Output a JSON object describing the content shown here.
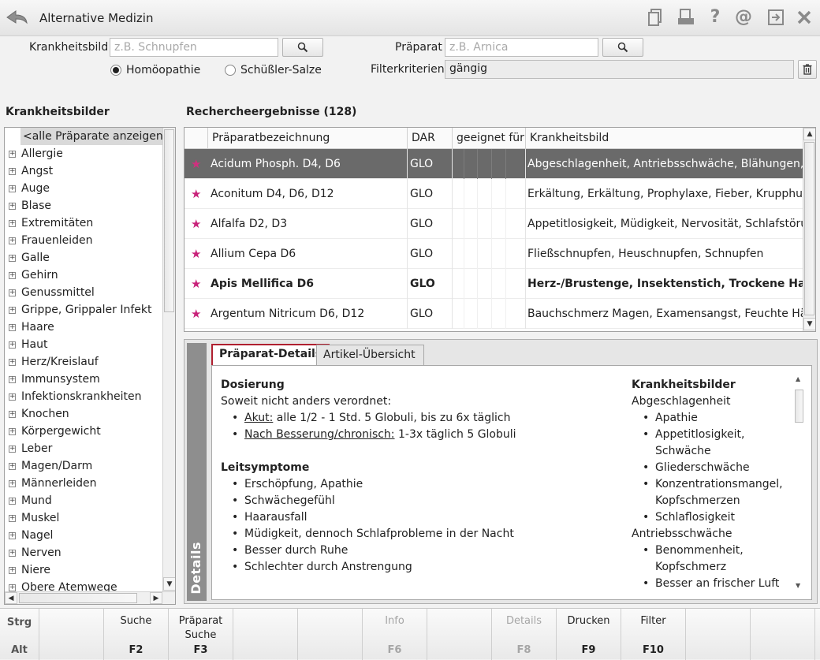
{
  "window": {
    "title": "Alternative Medizin"
  },
  "search": {
    "krankheitsbild_label": "Krankheitsbild",
    "krankheitsbild_placeholder": "z.B. Schnupfen",
    "praeparat_label": "Präparat",
    "praeparat_placeholder": "z.B. Arnica",
    "filter_label": "Filterkriterien",
    "filter_value": "gängig",
    "radio_homoeopathie": "Homöopathie",
    "radio_schuessler": "Schüßler-Salze",
    "selected_radio": "Homöopathie"
  },
  "left_panel": {
    "title": "Krankheitsbilder",
    "selected": "<alle Präparate anzeigen>",
    "items": [
      "Allergie",
      "Angst",
      "Auge",
      "Blase",
      "Extremitäten",
      "Frauenleiden",
      "Galle",
      "Gehirn",
      "Genussmittel",
      "Grippe, Grippaler Infekt",
      "Haare",
      "Haut",
      "Herz/Kreislauf",
      "Immunsystem",
      "Infektionskrankheiten",
      "Knochen",
      "Körpergewicht",
      "Leber",
      "Magen/Darm",
      "Männerleiden",
      "Mund",
      "Muskel",
      "Nagel",
      "Nerven",
      "Niere",
      "Obere Atemwege"
    ]
  },
  "results": {
    "title": "Rechercheergebnisse (128)",
    "columns": [
      "Präparatbezeichnung",
      "DAR",
      "geeignet für",
      "Krankheitsbild"
    ],
    "rows": [
      {
        "name": "Acidum Phosph. D4, D6",
        "dar": "GLO",
        "krankheitsbild": "Abgeschlagenheit, Antriebsschwäche, Blähungen, Depr"
      },
      {
        "name": "Aconitum D4, D6, D12",
        "dar": "GLO",
        "krankheitsbild": "Erkältung, Erkältung, Prophylaxe, Fieber, Krupphusten"
      },
      {
        "name": "Alfalfa D2, D3",
        "dar": "GLO",
        "krankheitsbild": "Appetitlosigkeit, Müdigkeit, Nervosität, Schlafstörung"
      },
      {
        "name": "Allium Cepa D6",
        "dar": "GLO",
        "krankheitsbild": "Fließschnupfen, Heuschnupfen, Schnupfen"
      },
      {
        "name": "Apis Mellifica D6",
        "dar": "GLO",
        "krankheitsbild": "Herz-/Brustenge, Insektenstich, Trockene Haut, Ve"
      },
      {
        "name": "Argentum Nitricum D6, D12",
        "dar": "GLO",
        "krankheitsbild": "Bauchschmerz Magen, Examensangst, Feuchte Hände"
      }
    ]
  },
  "details": {
    "side_label": "Details",
    "tab_details": "Präparat-Details",
    "tab_artikel": "Artikel-Übersicht",
    "dosierung_title": "Dosierung",
    "dosierung_intro": "Soweit nicht anders verordnet:",
    "akut_label": "Akut:",
    "akut_text": " alle 1/2 - 1 Std. 5 Globuli, bis zu 6x täglich",
    "chron_label": "Nach Besserung/chronisch:",
    "chron_text": " 1-3x täglich 5 Globuli",
    "leitsymptome_title": "Leitsymptome",
    "leitsymptome": [
      "Erschöpfung, Apathie",
      "Schwächegefühl",
      "Haarausfall",
      "Müdigkeit, dennoch Schlafprobleme in der Nacht",
      "Besser durch Ruhe",
      "Schlechter durch Anstrengung"
    ],
    "kb_title": "Krankheitsbilder",
    "kb_group1": "Abgeschlagenheit",
    "kb_list1": [
      "Apathie",
      "Appetitlosigkeit, Schwäche",
      "Gliederschwäche",
      "Konzentrationsmangel, Kopfschmerzen",
      "Schlaflosigkeit"
    ],
    "kb_group2": "Antriebsschwäche",
    "kb_list2": [
      "Benommenheit, Kopfschmerz",
      "Besser an frischer Luft"
    ]
  },
  "fbar": {
    "strg": "Strg",
    "alt": "Alt",
    "keys": [
      {
        "label": "",
        "key": ""
      },
      {
        "label": "Suche",
        "key": "F2"
      },
      {
        "label": "Präparat Suche",
        "key": "F3"
      },
      {
        "label": "",
        "key": ""
      },
      {
        "label": "",
        "key": ""
      },
      {
        "label": "Info",
        "key": "F6"
      },
      {
        "label": "",
        "key": ""
      },
      {
        "label": "Details",
        "key": "F8"
      },
      {
        "label": "Drucken",
        "key": "F9"
      },
      {
        "label": "Filter",
        "key": "F10"
      },
      {
        "label": "",
        "key": ""
      },
      {
        "label": "",
        "key": ""
      }
    ]
  }
}
